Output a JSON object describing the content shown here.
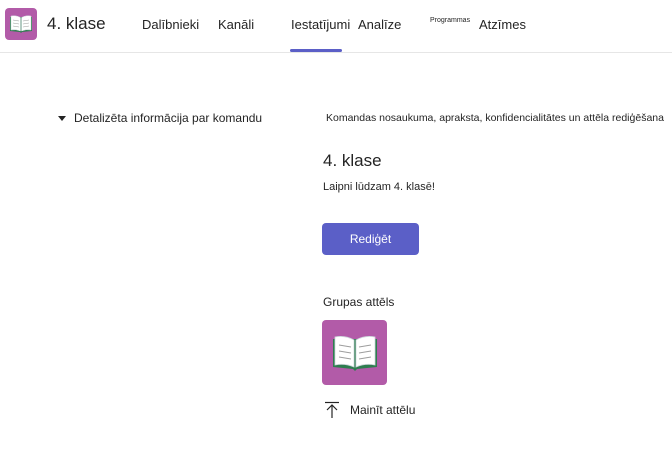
{
  "header": {
    "team_name": "4. klase",
    "avatar_icon": "open-book-icon",
    "tabs": [
      {
        "label": "Dalībnieki"
      },
      {
        "label": "Kanāli"
      },
      {
        "label": "Iestatījumi",
        "active": true
      },
      {
        "label": "Analīze"
      },
      {
        "label": "Atzīmes",
        "superscript": "Programmas"
      }
    ]
  },
  "settings": {
    "section_title": "Detalizēta informācija par komandu",
    "section_description": "Komandas nosaukuma, apraksta, konfidencialitātes un attēla rediģēšana",
    "team_title": "4. klase",
    "welcome_text": "Laipni lūdzam 4. klasē!",
    "edit_label": "Rediģēt",
    "group_image_label": "Grupas attēls",
    "group_image_icon": "open-book-icon",
    "change_image_label": "Mainīt attēlu",
    "change_image_icon": "upload-icon"
  },
  "colors": {
    "accent": "#5b5fc7",
    "avatar_bg": "#b25ba8"
  }
}
